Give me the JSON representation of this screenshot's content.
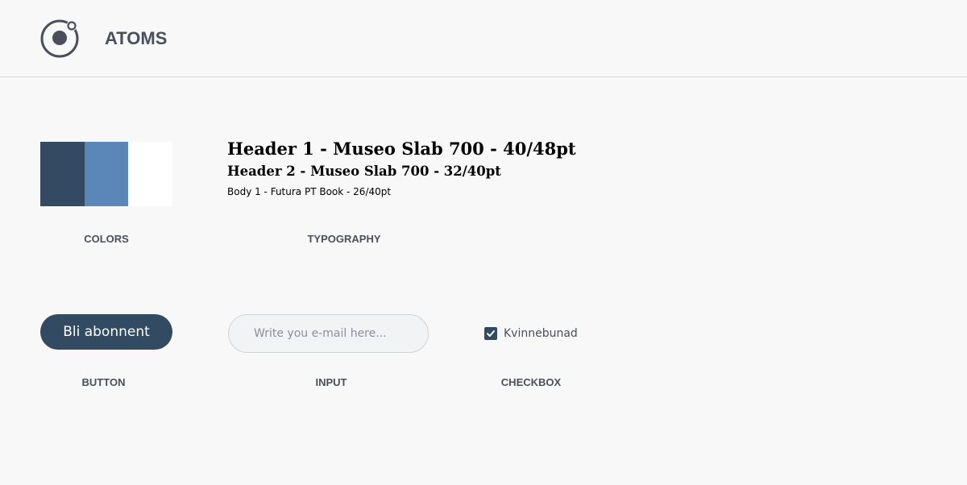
{
  "header": {
    "title": "ATOMS",
    "logo_icon": "ionic-logo-icon"
  },
  "colors": {
    "swatches": [
      "#344a63",
      "#5a87b8",
      "#ffffff"
    ],
    "label": "COLORS"
  },
  "typography": {
    "header1": "Header 1 - Museo Slab 700 - 40/48pt",
    "header2": "Header 2 - Museo Slab 700 - 32/40pt",
    "body1": "Body 1 - Futura PT Book - 26/40pt",
    "label": "TYPOGRAPHY"
  },
  "button": {
    "text": "Bli abonnent",
    "label": "BUTTON",
    "color": "#324a62"
  },
  "input": {
    "placeholder": "Write you e-mail here...",
    "value": "",
    "label": "INPUT"
  },
  "checkbox": {
    "text": "Kvinnebunad",
    "checked": true,
    "label": "CHECKBOX",
    "icon": "checkmark-icon"
  }
}
